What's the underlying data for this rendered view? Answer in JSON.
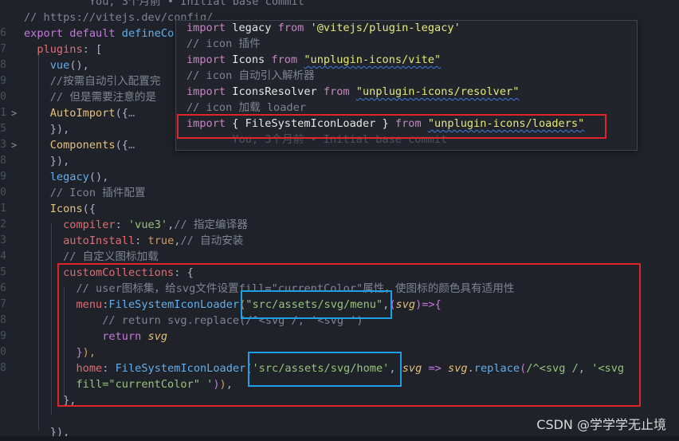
{
  "editor": {
    "lines": [
      {
        "n": "",
        "segs": [
          [
            "c-cm",
            "          You, 3个月前 • Initial base commit"
          ]
        ]
      },
      {
        "n": "",
        "segs": [
          [
            "c-cm",
            "// https://vitejs.dev/config/"
          ]
        ]
      },
      {
        "n": "6",
        "segs": [
          [
            "c-kw",
            "export "
          ],
          [
            "c-kw",
            "default "
          ],
          [
            "c-fn",
            "defineCo"
          ]
        ]
      },
      {
        "n": "7",
        "segs": [
          [
            "c-id",
            "  "
          ],
          [
            "c-prop",
            "plugins"
          ],
          [
            "c-id",
            ": ["
          ]
        ]
      },
      {
        "n": "8",
        "segs": [
          [
            "c-id",
            "    "
          ],
          [
            "c-fn",
            "vue"
          ],
          [
            "c-id",
            "(),"
          ]
        ]
      },
      {
        "n": "9",
        "segs": [
          [
            "c-cm",
            "    //按需自动引入配置完"
          ]
        ]
      },
      {
        "n": "0",
        "segs": [
          [
            "c-cm",
            "    // 但是需要注意的是"
          ]
        ]
      },
      {
        "n": "1",
        "fold": ">",
        "segs": [
          [
            "c-id",
            "    "
          ],
          [
            "c-yel",
            "AutoImport"
          ],
          [
            "c-id",
            "({"
          ],
          [
            "c-gl",
            "…"
          ]
        ]
      },
      {
        "n": "5",
        "segs": [
          [
            "c-id",
            "    }),"
          ]
        ]
      },
      {
        "n": "3",
        "fold": ">",
        "segs": [
          [
            "c-id",
            "    "
          ],
          [
            "c-yel",
            "Components"
          ],
          [
            "c-id",
            "({"
          ],
          [
            "c-gl",
            "…"
          ]
        ]
      },
      {
        "n": "8",
        "segs": [
          [
            "c-id",
            "    }),"
          ]
        ]
      },
      {
        "n": "9",
        "segs": [
          [
            "c-id",
            "    "
          ],
          [
            "c-fn",
            "legacy"
          ],
          [
            "c-id",
            "(),"
          ]
        ]
      },
      {
        "n": "0",
        "segs": [
          [
            "c-cm",
            "    // Icon 插件配置"
          ]
        ]
      },
      {
        "n": "1",
        "segs": [
          [
            "c-id",
            "    "
          ],
          [
            "c-yel",
            "Icons"
          ],
          [
            "c-id",
            "({"
          ]
        ]
      },
      {
        "n": "2",
        "segs": [
          [
            "c-id",
            "      "
          ],
          [
            "c-prop",
            "compiler"
          ],
          [
            "c-id",
            ": "
          ],
          [
            "c-str",
            "'vue3'"
          ],
          [
            "c-id",
            ","
          ],
          [
            "c-cm",
            "// 指定编译器"
          ]
        ]
      },
      {
        "n": "3",
        "segs": [
          [
            "c-id",
            "      "
          ],
          [
            "c-prop",
            "autoInstall"
          ],
          [
            "c-id",
            ": "
          ],
          [
            "c-bool",
            "true"
          ],
          [
            "c-id",
            ","
          ],
          [
            "c-cm",
            "// 自动安装"
          ]
        ]
      },
      {
        "n": "4",
        "segs": [
          [
            "c-cm",
            "      // 自定义图标加载"
          ]
        ]
      },
      {
        "n": "5",
        "segs": [
          [
            "c-id",
            "      "
          ],
          [
            "c-prop",
            "customCollections"
          ],
          [
            "c-id",
            ": {"
          ]
        ]
      },
      {
        "n": "6",
        "segs": [
          [
            "c-cm",
            "        // user图标集，给svg文件设置fill=\"currentColor\"属性，使图标的颜色具有适用性"
          ]
        ]
      },
      {
        "n": "7",
        "segs": [
          [
            "c-id",
            "        "
          ],
          [
            "c-prop",
            "menu"
          ],
          [
            "c-id",
            ":"
          ],
          [
            "c-fn",
            "FileSystemIconLoader"
          ],
          [
            "c-brk",
            "("
          ],
          [
            "c-str",
            "\"src/assets/svg/menu\""
          ],
          [
            "c-id",
            ","
          ],
          [
            "c-brk2",
            "("
          ],
          [
            "c-it",
            "svg"
          ],
          [
            "c-brk2",
            ")"
          ],
          [
            "c-kw",
            "=>"
          ],
          [
            "c-brk2",
            "{"
          ]
        ]
      },
      {
        "n": "8",
        "segs": [
          [
            "c-cm",
            "            // return svg.replace(/^<svg /, '<svg ')"
          ]
        ]
      },
      {
        "n": "9",
        "segs": [
          [
            "c-id",
            "            "
          ],
          [
            "c-kw",
            "return "
          ],
          [
            "c-it",
            "svg"
          ]
        ]
      },
      {
        "n": "0",
        "segs": [
          [
            "c-id",
            "        "
          ],
          [
            "c-brk2",
            "}"
          ],
          [
            "c-brk",
            "),"
          ]
        ]
      },
      {
        "n": "8",
        "segs": [
          [
            "c-id",
            "        "
          ],
          [
            "c-prop",
            "home"
          ],
          [
            "c-id",
            ": "
          ],
          [
            "c-fn",
            "FileSystemIconLoader"
          ],
          [
            "c-brk",
            "("
          ],
          [
            "c-str",
            "'src/assets/svg/home'"
          ],
          [
            "c-id",
            ", "
          ],
          [
            "c-it",
            "svg"
          ],
          [
            "c-kw",
            " => "
          ],
          [
            "c-it",
            "svg"
          ],
          [
            "c-id",
            "."
          ],
          [
            "c-fn",
            "replace"
          ],
          [
            "c-brk2",
            "("
          ],
          [
            "c-str",
            "/^<svg /"
          ],
          [
            "c-id",
            ", "
          ],
          [
            "c-str",
            "'<svg"
          ]
        ]
      },
      {
        "n": "",
        "segs": [
          [
            "c-str",
            "        fill=\"currentColor\" '"
          ],
          [
            "c-brk2",
            ")"
          ],
          [
            "c-brk",
            ")"
          ],
          [
            "c-id",
            ","
          ]
        ]
      },
      {
        "n": "",
        "segs": [
          [
            "c-id",
            "      },"
          ]
        ]
      },
      {
        "n": "",
        "segs": [
          [
            "c-id",
            ""
          ]
        ]
      },
      {
        "n": "",
        "segs": [
          [
            "c-id",
            "    }),"
          ]
        ]
      }
    ]
  },
  "popup": {
    "lines": [
      {
        "segs": [
          [
            "c-kw",
            "import "
          ],
          [
            "c-pw",
            "legacy "
          ],
          [
            "c-kw",
            "from "
          ],
          [
            "c-str",
            "'@vitejs/plugin-legacy'"
          ]
        ]
      },
      {
        "segs": [
          [
            "c-cm",
            "// icon 插件"
          ]
        ]
      },
      {
        "segs": [
          [
            "c-kw",
            "import "
          ],
          [
            "c-pw",
            "Icons "
          ],
          [
            "c-kw",
            "from "
          ],
          [
            "c-strsq",
            "\"unplugin-icons/vite\""
          ]
        ]
      },
      {
        "segs": [
          [
            "c-cm",
            "// icon 自动引入解析器"
          ]
        ]
      },
      {
        "segs": [
          [
            "c-kw",
            "import "
          ],
          [
            "c-pw",
            "IconsResolver "
          ],
          [
            "c-kw",
            "from "
          ],
          [
            "c-strsq",
            "\"unplugin-icons/resolver\""
          ]
        ]
      },
      {
        "segs": [
          [
            "c-cm",
            "// icon 加载 loader"
          ]
        ]
      },
      {
        "segs": [
          [
            "c-kw",
            "import "
          ],
          [
            "c-pw",
            "{ FileSystemIconLoader } "
          ],
          [
            "c-kw",
            "from "
          ],
          [
            "c-strsq",
            "\"unplugin-icons/loaders\""
          ]
        ]
      },
      {
        "segs": [
          [
            "c-cm",
            "       You, 3个月前 • Initial base commit"
          ]
        ]
      }
    ]
  },
  "watermark": "CSDN @学学学无止境",
  "colors": {
    "background": "#1f2329",
    "highlight_box_red": "#e0242b",
    "highlight_box_blue": "#1ea0e8"
  }
}
